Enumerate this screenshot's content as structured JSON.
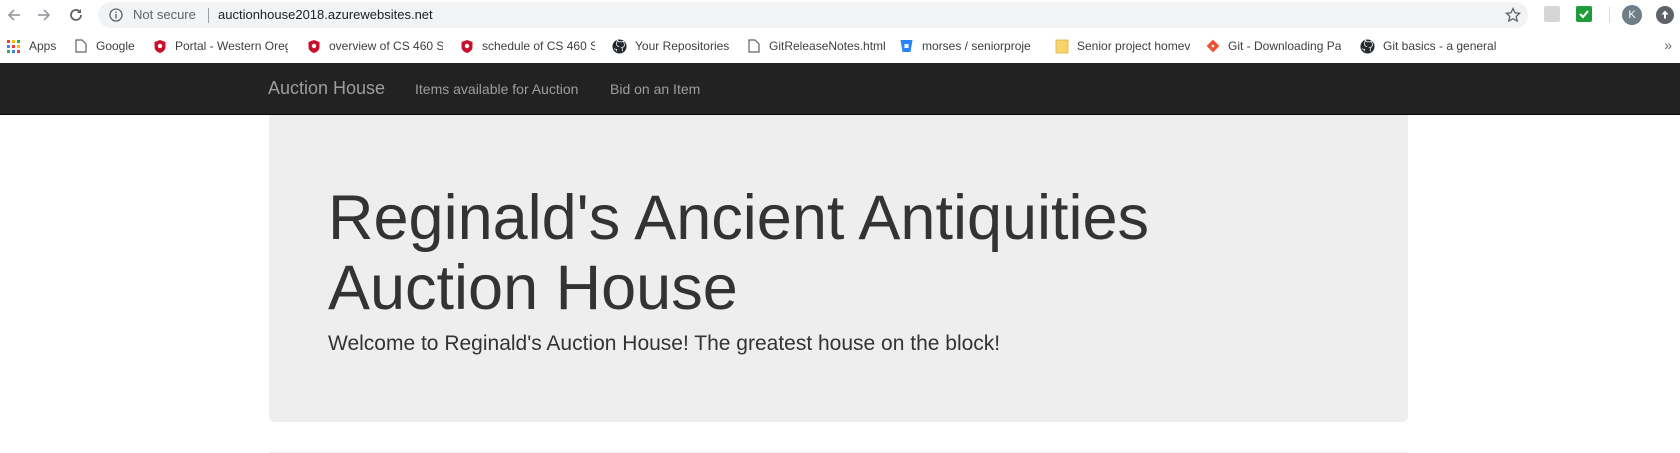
{
  "browser": {
    "security_label": "Not secure",
    "url": "auctionhouse2018.azurewebsites.net",
    "avatar_letter": "K"
  },
  "bookmarks": {
    "items": [
      {
        "label": "Apps",
        "icon": "apps-grid-icon"
      },
      {
        "label": "Google",
        "icon": "page-icon"
      },
      {
        "label": "Portal - Western Oreg",
        "icon": "wou-shield-icon"
      },
      {
        "label": "overview of CS 460 S",
        "icon": "wou-shield-icon"
      },
      {
        "label": "schedule of CS 460 S",
        "icon": "wou-shield-icon"
      },
      {
        "label": "Your Repositories",
        "icon": "github-icon"
      },
      {
        "label": "GitReleaseNotes.html",
        "icon": "page-icon"
      },
      {
        "label": "morses / seniorproje",
        "icon": "bitbucket-icon"
      },
      {
        "label": "Senior project homev",
        "icon": "folder-icon"
      },
      {
        "label": "Git - Downloading Pa",
        "icon": "git-icon"
      },
      {
        "label": "Git basics - a general",
        "icon": "github-icon"
      }
    ],
    "more": "»"
  },
  "navbar": {
    "brand": "Auction House",
    "links": [
      "Items available for Auction",
      "Bid on an Item"
    ],
    "bg_color": "#222222",
    "text_color": "#9d9d9d"
  },
  "jumbotron": {
    "title": "Reginald's Ancient Antiquities Auction House",
    "lead": "Welcome to Reginald's Auction House! The greatest house on the block!",
    "bg_color": "#eeeeee"
  }
}
